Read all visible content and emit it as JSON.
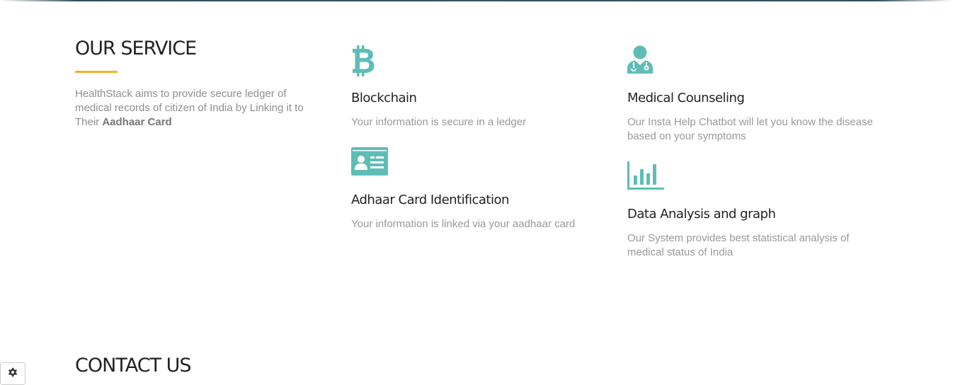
{
  "service_section": {
    "heading": "OUR SERVICE",
    "intro_text": "HealthStack aims to provide secure ledger of medical records of citizen of India by Linking it to Their ",
    "intro_bold": "Aadhaar Card",
    "accent_color": "#f0b429",
    "icon_color": "#5fbdb8"
  },
  "services": [
    {
      "icon": "bitcoin-icon",
      "title": "Blockchain",
      "description": "Your information is secure in a ledger"
    },
    {
      "icon": "id-card-icon",
      "title": "Adhaar Card Identification",
      "description": "Your information is linked via your aadhaar card"
    },
    {
      "icon": "doctor-icon",
      "title": "Medical Counseling",
      "description": "Our Insta Help Chatbot will let you know the disease based on your symptoms"
    },
    {
      "icon": "bar-chart-icon",
      "title": "Data Analysis and graph",
      "description": "Our System provides best statistical analysis of medical status of India"
    }
  ],
  "contact_section": {
    "heading": "CONTACT US"
  },
  "settings": {
    "icon": "gear-icon"
  }
}
